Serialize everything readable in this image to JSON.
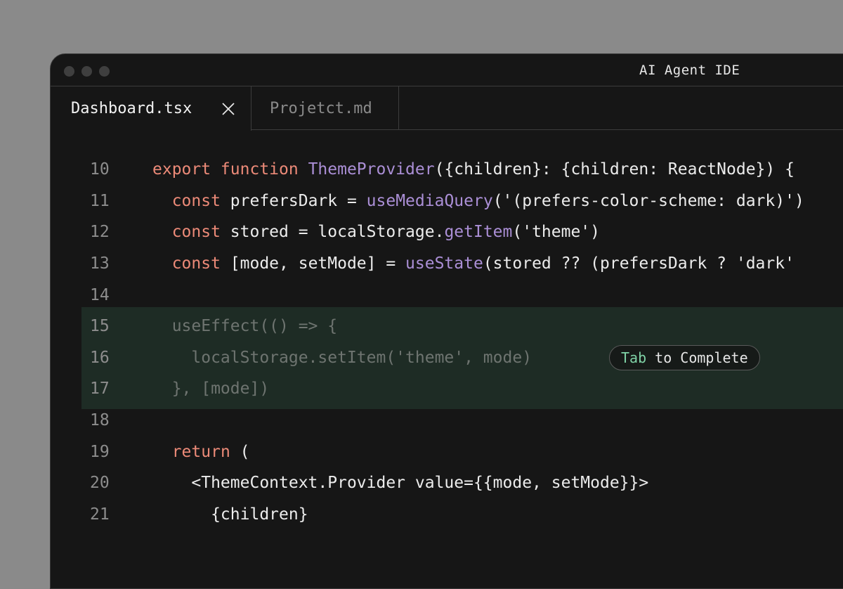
{
  "window": {
    "title": "AI Agent IDE"
  },
  "tabs": [
    {
      "label": "Dashboard.tsx",
      "active": true,
      "close_icon": "close-icon"
    },
    {
      "label": "Projetct.md",
      "active": false
    }
  ],
  "editor": {
    "lines": [
      {
        "number": "10",
        "kw1": "export function ",
        "fn1": "ThemeProvider",
        "rest": "({children}: {children: ReactNode}) {"
      },
      {
        "number": "11",
        "indent": "  ",
        "kw1": "const ",
        "t1": "prefersDark = ",
        "fn1": "useMediaQuery",
        "rest": "('(prefers-color-scheme: dark)')"
      },
      {
        "number": "12",
        "indent": "  ",
        "kw1": "const ",
        "t1": "stored = localStorage.",
        "fn1": "getItem",
        "rest": "('theme')"
      },
      {
        "number": "13",
        "indent": "  ",
        "kw1": "const ",
        "t1": "[mode, setMode] = ",
        "fn1": "useState",
        "rest": "(stored ?? (prefersDark ? 'dark'"
      },
      {
        "number": "14",
        "text": ""
      },
      {
        "number": "15",
        "text": "  useEffect(() => {"
      },
      {
        "number": "16",
        "text": "    localStorage.setItem('theme', mode)"
      },
      {
        "number": "17",
        "text": "  }, [mode])"
      },
      {
        "number": "18",
        "text": ""
      },
      {
        "number": "19",
        "indent": "  ",
        "kw1": "return",
        "rest": " ("
      },
      {
        "number": "20",
        "text": "    <ThemeContext.Provider value={{mode, setMode}}>"
      },
      {
        "number": "21",
        "text": "      {children}"
      }
    ],
    "suggestion_hint": {
      "key": "Tab",
      "text": " to Complete"
    }
  },
  "colors": {
    "keyword": "#ec8a78",
    "function": "#ab8fd6",
    "suggestion_bg": "#1e2c25",
    "hint_key": "#7fd2a6"
  }
}
